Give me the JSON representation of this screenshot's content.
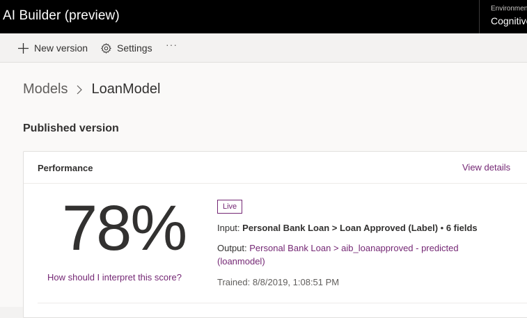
{
  "app": {
    "title": "AI Builder (preview)"
  },
  "environment": {
    "label": "Environment",
    "value": "Cognitive"
  },
  "commandbar": {
    "new_version": "New version",
    "settings": "Settings",
    "more": "···"
  },
  "breadcrumb": {
    "parent": "Models",
    "current": "LoanModel"
  },
  "section": {
    "title": "Published version"
  },
  "performance": {
    "title": "Performance",
    "view_details": "View details",
    "score": "78%",
    "interpret_link": "How should I interpret this score?",
    "badge": "Live",
    "input_label": "Input:",
    "input_value": "Personal Bank Loan > Loan Approved (Label)",
    "input_bullet": "•",
    "input_fields": "6 fields",
    "output_label": "Output:",
    "output_value_line1": "Personal Bank Loan > aib_loanapproved - predicted",
    "output_value_line2": "(loanmodel)",
    "trained": "Trained: 8/8/2019, 1:08:51 PM"
  },
  "colors": {
    "topbar": "#000000",
    "accent": "#742774",
    "text": "#323130"
  },
  "icons": {
    "new_version": "plus-icon",
    "settings": "gear-icon",
    "breadcrumb_separator": "chevron-right-icon"
  }
}
